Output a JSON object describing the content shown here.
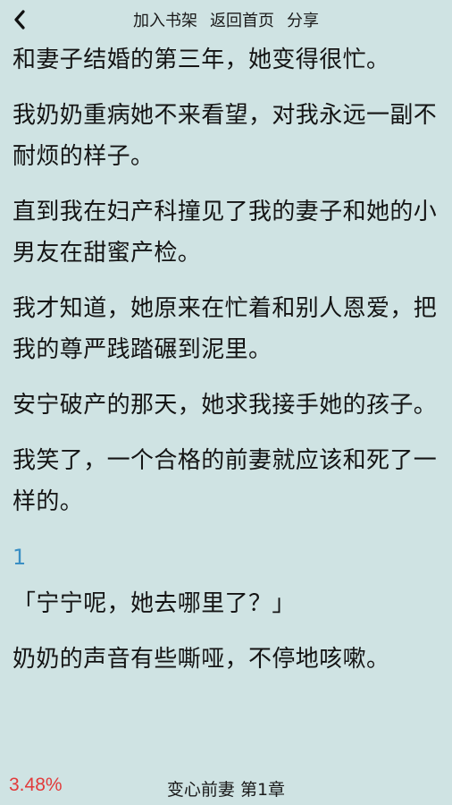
{
  "topbar": {
    "add_to_shelf": "加入书架",
    "back_home": "返回首页",
    "share": "分享"
  },
  "content": {
    "paragraphs": [
      "和妻子结婚的第三年，她变得很忙。",
      "我奶奶重病她不来看望，对我永远一副不耐烦的样子。",
      "直到我在妇产科撞见了我的妻子和她的小男友在甜蜜产检。",
      "我才知道，她原来在忙着和别人恩爱，把我的尊严践踏碾到泥里。",
      "安宁破产的那天，她求我接手她的孩子。",
      "我笑了，一个合格的前妻就应该和死了一样的。"
    ],
    "section_number": "1",
    "paragraphs2": [
      "「宁宁呢，她去哪里了？」",
      "奶奶的声音有些嘶哑，不停地咳嗽。"
    ]
  },
  "footer": {
    "progress": "3.48%",
    "book_chapter": "变心前妻 第1章"
  },
  "colors": {
    "background": "#cfe3e3",
    "section_number": "#3a8fc4",
    "progress": "#e23a3a"
  }
}
